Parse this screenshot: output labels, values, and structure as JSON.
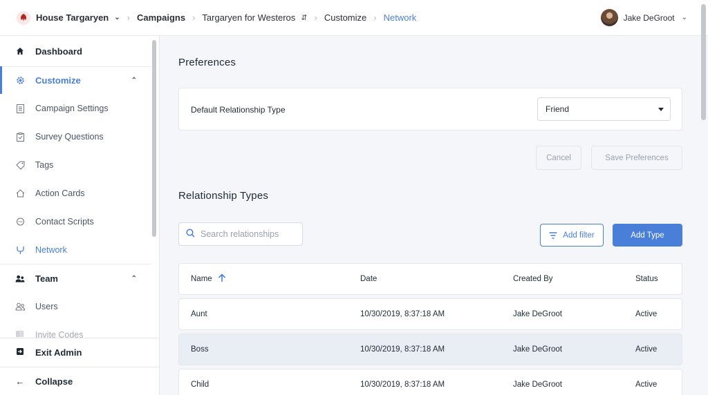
{
  "header": {
    "org_name": "House Targaryen",
    "breadcrumbs": [
      "Campaigns",
      "Targaryen for Westeros",
      "Customize",
      "Network"
    ],
    "user_name": "Jake DeGroot"
  },
  "sidebar": {
    "items": [
      {
        "label": "Dashboard",
        "icon": "home-icon"
      },
      {
        "label": "Customize",
        "icon": "gear-icon"
      },
      {
        "label": "Campaign Settings",
        "icon": "document-icon"
      },
      {
        "label": "Survey Questions",
        "icon": "clipboard-icon"
      },
      {
        "label": "Tags",
        "icon": "tag-icon"
      },
      {
        "label": "Action Cards",
        "icon": "house-outline-icon"
      },
      {
        "label": "Contact Scripts",
        "icon": "chat-bubble-icon"
      },
      {
        "label": "Network",
        "icon": "network-icon"
      },
      {
        "label": "Team",
        "icon": "team-icon"
      },
      {
        "label": "Users",
        "icon": "users-icon"
      },
      {
        "label": "Invite Codes",
        "icon": "barcode-icon"
      }
    ],
    "exit_label": "Exit Admin",
    "collapse_label": "Collapse"
  },
  "preferences": {
    "title": "Preferences",
    "default_type_label": "Default Relationship Type",
    "default_type_value": "Friend",
    "cancel_label": "Cancel",
    "save_label": "Save Preferences"
  },
  "relationships": {
    "title": "Relationship Types",
    "search_placeholder": "Search relationships",
    "add_filter_label": "Add filter",
    "add_type_label": "Add Type",
    "columns": [
      "Name",
      "Date",
      "Created By",
      "Status"
    ],
    "rows": [
      {
        "name": "Aunt",
        "date": "10/30/2019, 8:37:18 AM",
        "created_by": "Jake DeGroot",
        "status": "Active"
      },
      {
        "name": "Boss",
        "date": "10/30/2019, 8:37:18 AM",
        "created_by": "Jake DeGroot",
        "status": "Active"
      },
      {
        "name": "Child",
        "date": "10/30/2019, 8:37:18 AM",
        "created_by": "Jake DeGroot",
        "status": "Active"
      }
    ]
  },
  "colors": {
    "accent": "#4a7fd9",
    "background": "#f5f6f9",
    "highlight_row": "#e9eef5"
  }
}
